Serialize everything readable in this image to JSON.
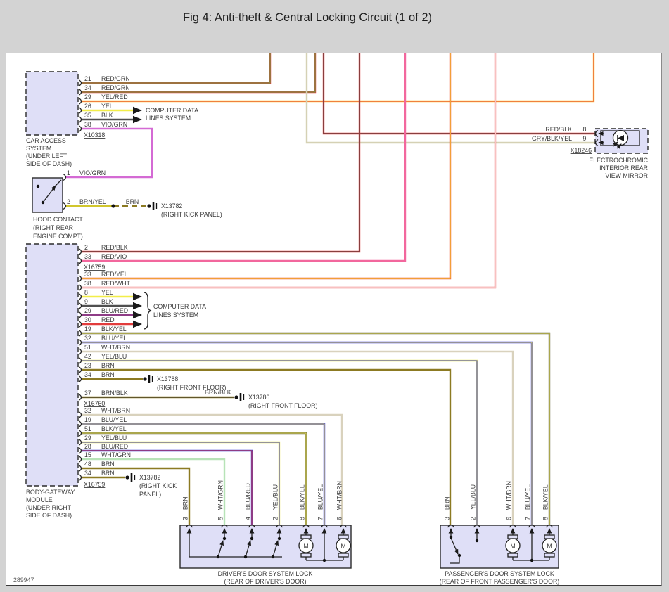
{
  "title": "Fig 4: Anti-theft & Central Locking Circuit (1 of 2)",
  "footer": {
    "diagram_number": "289947"
  },
  "colors": {
    "page_bg": "#d3d3d3",
    "canvas_bg": "#ffffff",
    "block_fill": "#dfdff7",
    "block_border": "#2b2b2b",
    "text": "#3b3b3b",
    "wire_colors": {
      "RED/GRN": "#e23c3c",
      "YEL/RED": "#ffc53d",
      "YEL": "#f2ee49",
      "BLK": "#4f4f4f",
      "VIO/GRN": "#d46ad4",
      "RED/BLK": "#e04848",
      "GRY/BLK/YEL": "#d5d1b4",
      "RED/VIO": "#f2679d",
      "RED/YEL": "#ee5c35",
      "RED/WHT": "#f08080",
      "BLU/RED": "#3b3bd0",
      "BLK/YEL": "#6e6e45",
      "BLU/YEL": "#4343d8",
      "WHT/BRN": "#d9d2bd",
      "YEL/BLU": "#eeeb60",
      "BRN": "#8c7a22",
      "BRN/YEL": "#b09d10",
      "BRN/BLK": "#8c7a22",
      "WHT/GRN": "#b7e3b7",
      "RED": "#e23c3c"
    }
  },
  "annotations": {
    "computer_data_line1": "COMPUTER DATA",
    "computer_data_line2": "LINES SYSTEM",
    "motor_label": "M",
    "splice_x13788": {
      "id": "X13788",
      "location": "(RIGHT FRONT FLOOR)"
    },
    "splice_x13786": {
      "id": "X13786",
      "location": "(RIGHT FRONT FLOOR)",
      "wire_label": "BRN/BLK"
    },
    "splice_x13782_hood": {
      "id": "X13782",
      "location": "(RIGHT KICK PANEL)",
      "wire_label": "BRN"
    },
    "splice_x13782_body": {
      "id": "X13782",
      "location_line1": "(RIGHT KICK",
      "location_line2": "PANEL)"
    }
  },
  "blocks": {
    "car_access": {
      "label_line1": "CAR ACCESS",
      "label_line2": "SYSTEM",
      "label_line3": "(UNDER LEFT",
      "label_line4": "SIDE OF DASH)",
      "connector": "X10318",
      "pins": [
        {
          "num": "21",
          "wire": "RED/GRN"
        },
        {
          "num": "34",
          "wire": "RED/GRN"
        },
        {
          "num": "29",
          "wire": "YEL/RED"
        },
        {
          "num": "26",
          "wire": "YEL"
        },
        {
          "num": "35",
          "wire": "BLK"
        },
        {
          "num": "38",
          "wire": "VIO/GRN"
        }
      ]
    },
    "mirror": {
      "label_line1": "ELECTROCHROMIC",
      "label_line2": "INTERIOR REAR",
      "label_line3": "VIEW MIRROR",
      "connector": "X18246",
      "pins": [
        {
          "num": "8",
          "wire": "RED/BLK"
        },
        {
          "num": "9",
          "wire": "GRY/BLK/YEL"
        }
      ]
    },
    "hood_contact": {
      "label_line1": "HOOD CONTACT",
      "label_line2": "(RIGHT REAR",
      "label_line3": "ENGINE COMPT)",
      "pins": [
        {
          "num": "1",
          "wire": "VIO/GRN"
        },
        {
          "num": "2",
          "wire": "BRN/YEL"
        }
      ]
    },
    "body_gateway": {
      "label_line1": "BODY-GATEWAY",
      "label_line2": "MODULE",
      "label_line3": "(UNDER RIGHT",
      "label_line4": "SIDE OF DASH)",
      "connector_top": "X16759",
      "connector_mid": "X16760",
      "connector_bottom": "X16759",
      "pins": [
        {
          "num": "2",
          "wire": "RED/BLK"
        },
        {
          "num": "33",
          "wire": "RED/VIO"
        },
        {
          "num": "33",
          "wire": "RED/YEL"
        },
        {
          "num": "38",
          "wire": "RED/WHT"
        },
        {
          "num": "8",
          "wire": "YEL"
        },
        {
          "num": "9",
          "wire": "BLK"
        },
        {
          "num": "29",
          "wire": "BLU/RED"
        },
        {
          "num": "30",
          "wire": "RED"
        },
        {
          "num": "19",
          "wire": "BLK/YEL"
        },
        {
          "num": "32",
          "wire": "BLU/YEL"
        },
        {
          "num": "51",
          "wire": "WHT/BRN"
        },
        {
          "num": "42",
          "wire": "YEL/BLU"
        },
        {
          "num": "23",
          "wire": "BRN"
        },
        {
          "num": "34",
          "wire": "BRN"
        },
        {
          "num": "37",
          "wire": "BRN/BLK"
        },
        {
          "num": "32",
          "wire": "WHT/BRN"
        },
        {
          "num": "19",
          "wire": "BLU/YEL"
        },
        {
          "num": "51",
          "wire": "BLK/YEL"
        },
        {
          "num": "29",
          "wire": "YEL/BLU"
        },
        {
          "num": "28",
          "wire": "BLU/RED"
        },
        {
          "num": "15",
          "wire": "WHT/GRN"
        },
        {
          "num": "48",
          "wire": "BRN"
        },
        {
          "num": "34",
          "wire": "BRN"
        }
      ]
    },
    "drivers_door": {
      "label_line1": "DRIVER'S DOOR SYSTEM LOCK",
      "label_line2": "(REAR OF DRIVER'S DOOR)",
      "pins": [
        {
          "num": "3",
          "wire": "BRN"
        },
        {
          "num": "5",
          "wire": "WHT/GRN"
        },
        {
          "num": "4",
          "wire": "BLU/RED"
        },
        {
          "num": "2",
          "wire": "YEL/BLU"
        },
        {
          "num": "8",
          "wire": "BLK/YEL"
        },
        {
          "num": "7",
          "wire": "BLU/YEL"
        },
        {
          "num": "6",
          "wire": "WHT/BRN"
        }
      ]
    },
    "passengers_door": {
      "label_line1": "PASSENGER'S DOOR SYSTEM LOCK",
      "label_line2": "(REAR OF FRONT PASSENGER'S DOOR)",
      "pins": [
        {
          "num": "3",
          "wire": "BRN"
        },
        {
          "num": "2",
          "wire": "YEL/BLU"
        },
        {
          "num": "6",
          "wire": "WHT/BRN"
        },
        {
          "num": "7",
          "wire": "BLU/YEL"
        },
        {
          "num": "8",
          "wire": "BLK/YEL"
        }
      ]
    }
  }
}
